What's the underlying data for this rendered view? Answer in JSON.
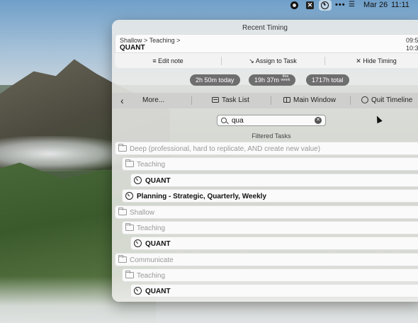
{
  "menubar": {
    "date": "Mar 26",
    "time": "11:11",
    "icons": [
      "record-icon",
      "x-app-icon",
      "timing-app-icon",
      "more-dots-icon",
      "control-center-icon"
    ]
  },
  "popover": {
    "recent_title": "Recent Timing",
    "recent_path": "Shallow > Teaching >",
    "recent_task": "QUANT",
    "recent_time_start": "09:5",
    "recent_time_end": "10:3",
    "actions": {
      "edit_note": "≡ Edit note",
      "assign_task": "↘ Assign to Task",
      "hide_timing": "✕ Hide Timing"
    },
    "stats": {
      "today": "2h 50m today",
      "week_value": "19h 37m",
      "week_label_top": "this",
      "week_label_bottom": "week",
      "total": "1717h total"
    },
    "toolbar": {
      "back": "‹",
      "more": "More...",
      "task_list": "Task List",
      "main_window": "Main Window",
      "quit": "Quit Timeline"
    },
    "search": {
      "value": "qua",
      "clear": "✕"
    },
    "filtered_title": "Filtered Tasks",
    "rows": [
      {
        "kind": "cat",
        "label": "Deep (professional, hard to replicate, AND create new value)"
      },
      {
        "kind": "cat",
        "label": "Teaching"
      },
      {
        "kind": "task",
        "label": "QUANT"
      },
      {
        "kind": "task",
        "label": "Planning - Strategic, Quarterly, Weekly"
      },
      {
        "kind": "cat",
        "label": "Shallow"
      },
      {
        "kind": "cat",
        "label": "Teaching"
      },
      {
        "kind": "task",
        "label": "QUANT"
      },
      {
        "kind": "cat",
        "label": "Communicate"
      },
      {
        "kind": "cat",
        "label": "Teaching"
      },
      {
        "kind": "task",
        "label": "QUANT"
      }
    ]
  }
}
